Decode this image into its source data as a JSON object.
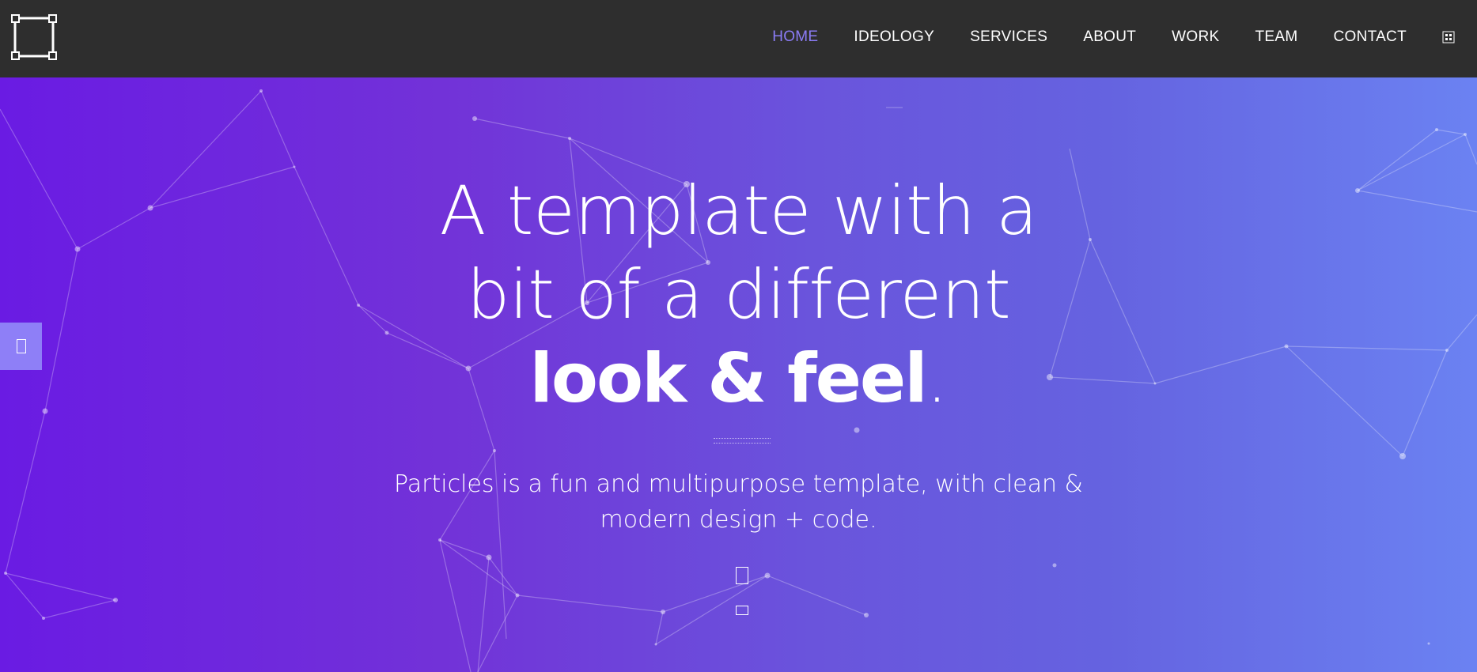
{
  "nav": {
    "items": [
      {
        "label": "HOME",
        "active": true
      },
      {
        "label": "IDEOLOGY",
        "active": false
      },
      {
        "label": "SERVICES",
        "active": false
      },
      {
        "label": "ABOUT",
        "active": false
      },
      {
        "label": "WORK",
        "active": false
      },
      {
        "label": "TEAM",
        "active": false
      },
      {
        "label": "CONTACT",
        "active": false
      }
    ],
    "active_color": "#8b7cf6",
    "background": "#2e2e2e",
    "logo_icon": "frame-logo-icon",
    "search_icon": "search-icon"
  },
  "hero": {
    "headline_line1": "A template with a",
    "headline_line2": "bit of a different",
    "headline_bold": "look & feel",
    "headline_period": ".",
    "subtitle_line1": "Particles is a fun and multipurpose template, with clean &",
    "subtitle_line2": "modern design + code.",
    "gradient": [
      "#6a1be3",
      "#7232d8",
      "#6a54dc",
      "#6563e0",
      "#6b82f2"
    ]
  },
  "side_tab": {
    "icon": "settings-icon",
    "color": "#8e7ff7"
  }
}
